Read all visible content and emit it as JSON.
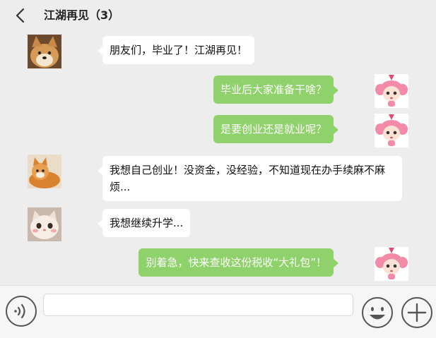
{
  "header": {
    "title": "江湖再见（3）"
  },
  "messages": [
    {
      "side": "left",
      "avatar": "shiba-dog-avatar",
      "text": "朋友们，毕业了！江湖再见！"
    },
    {
      "side": "right",
      "avatar": "pink-doll-avatar",
      "text": "毕业后大家准备干啥？"
    },
    {
      "side": "right",
      "avatar": "pink-doll-avatar",
      "text": "是要创业还是就业呢？"
    },
    {
      "side": "left",
      "avatar": "orange-cat-avatar",
      "text": "我想自己创业！没资金，没经验，不知道现在办手续麻不麻烦..."
    },
    {
      "side": "left",
      "avatar": "white-cat-avatar",
      "text": "我想继续升学..."
    },
    {
      "side": "right",
      "avatar": "pink-doll-avatar",
      "text": "别着急，快来查收这份税收“大礼包”！"
    }
  ],
  "input": {
    "value": "",
    "placeholder": ""
  },
  "icons": {
    "back": "chevron-left-icon",
    "voice": "voice-icon",
    "emoji": "smile-icon",
    "plus": "plus-icon"
  },
  "colors": {
    "background": "#ededed",
    "bubble_self": "#8fd16a",
    "bubble_other": "#ffffff"
  }
}
